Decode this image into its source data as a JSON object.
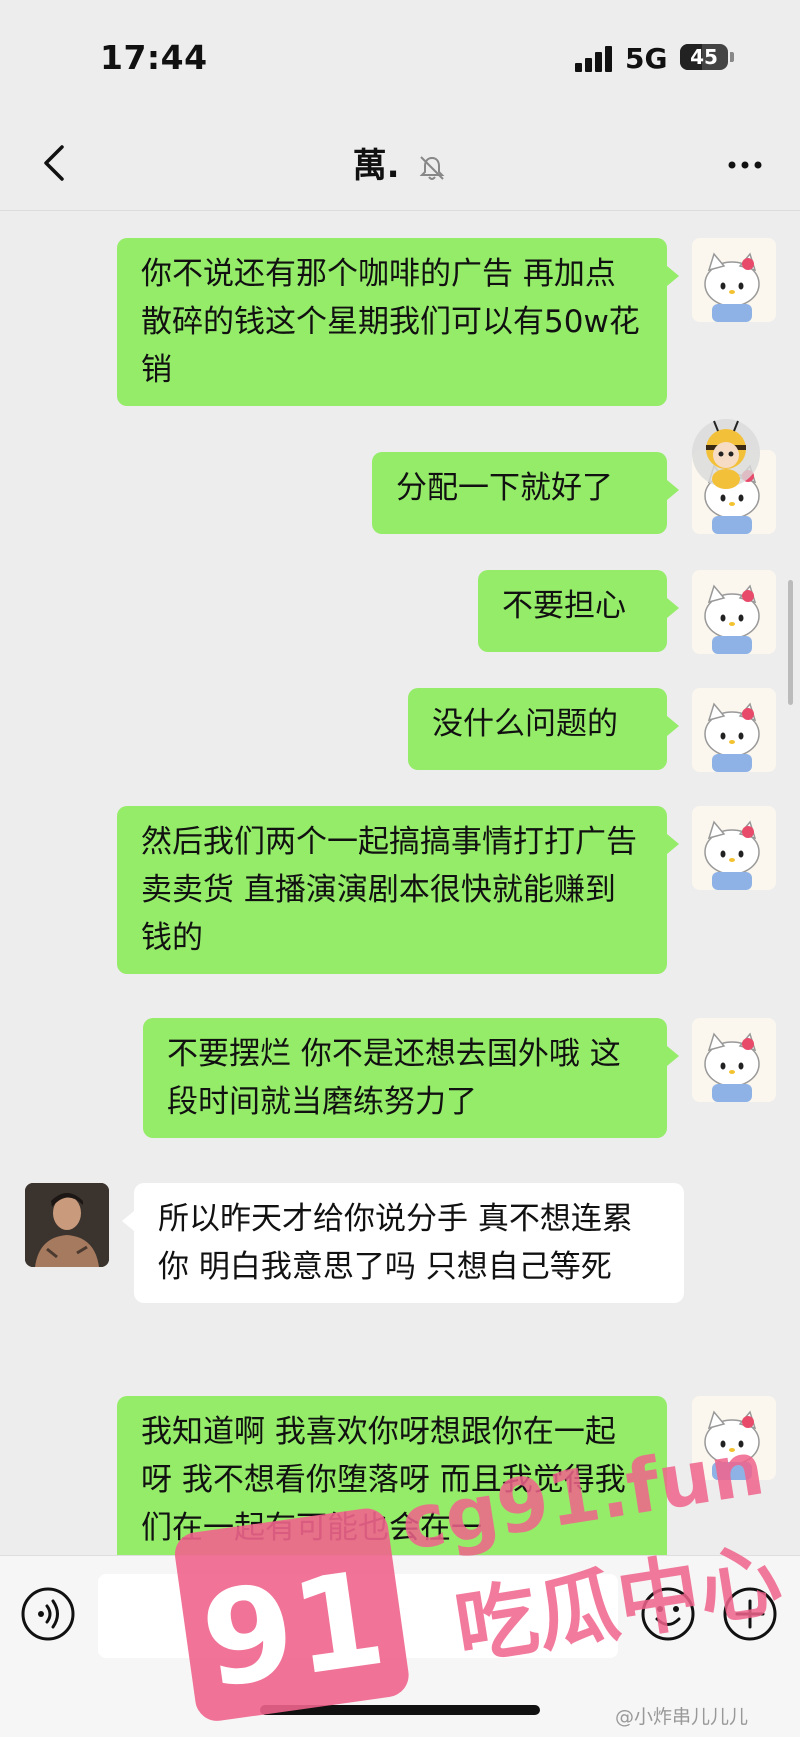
{
  "status_bar": {
    "time": "17:44",
    "network": "5G",
    "battery": "45"
  },
  "header": {
    "title": "萬."
  },
  "messages": [
    {
      "sender": "me",
      "text": "你不说还有那个咖啡的广告 再加点散碎的钱这个星期我们可以有50w花销"
    },
    {
      "sender": "me",
      "text": "分配一下就好了"
    },
    {
      "sender": "me",
      "text": "不要担心"
    },
    {
      "sender": "me",
      "text": "没什么问题的"
    },
    {
      "sender": "me",
      "text": "然后我们两个一起搞搞事情打打广告卖卖货 直播演演剧本很快就能赚到钱的"
    },
    {
      "sender": "me",
      "text": "不要摆烂 你不是还想去国外哦 这段时间就当磨练努力了"
    },
    {
      "sender": "them",
      "text": "所以昨天才给你说分手 真不想连累你 明白我意思了吗 只想自己等死"
    },
    {
      "sender": "me",
      "text": "我知道啊 我喜欢你呀想跟你在一起呀 我不想看你堕落呀 而且我觉得我们在一起有可能也会在一"
    }
  ],
  "input_bar": {
    "placeholder": ""
  },
  "watermark": {
    "logo_number": "91",
    "site": "cg91.fun",
    "slogan": "吃瓜中心",
    "credit": "@小炸串儿儿儿"
  },
  "colors": {
    "my_bubble": "#95ec69",
    "their_bubble": "#ffffff",
    "background": "#ededed",
    "watermark_pink": "#f0648c"
  }
}
